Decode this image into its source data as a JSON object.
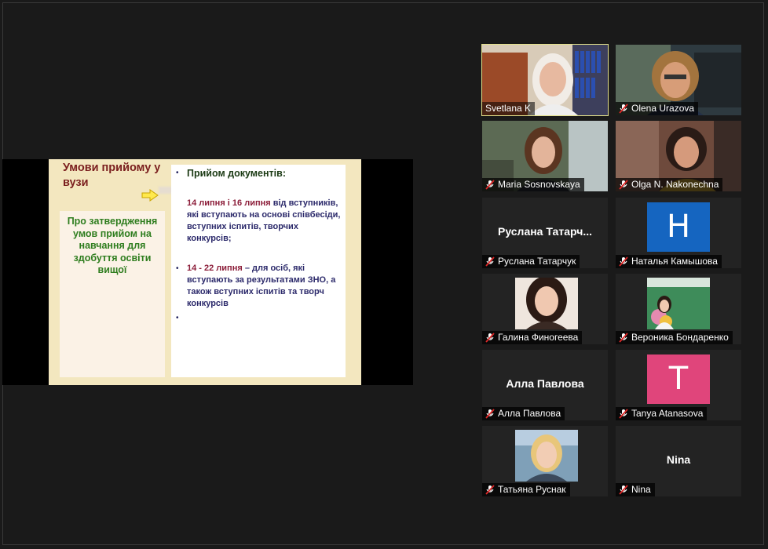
{
  "slide": {
    "title": "Умови прийому у вузи",
    "left_text": "Про затвердження умов прийом на навчання для здобуття освіти вищої",
    "heading": "Прийом документів:",
    "item1_dates": "14 липня і 16 липня",
    "item1_text": " від вступників, які вступають на основі співбесіди, вступних іспитів, творчих конкурсів;",
    "item2_dates": "14 - 22 липня",
    "item2_text": " – для осіб, які вступають за результатами ЗНО, а також вступних іспитів та творч конкурсів",
    "bullet": "•"
  },
  "participants": [
    {
      "name": "Svetlana K",
      "muted": false,
      "active": true
    },
    {
      "name": "Olena Urazova",
      "muted": true
    },
    {
      "name": "Maria Sosnovskaya",
      "muted": true
    },
    {
      "name": "Olga N. Nakonechna",
      "muted": true
    },
    {
      "name": "Руслана Татарчук",
      "display": "Руслана  Татарч...",
      "muted": true
    },
    {
      "name": "Наталья Камышова",
      "avatar": "H",
      "avatar_color": "#1565c0",
      "muted": true
    },
    {
      "name": "Галина Финогеева",
      "muted": true
    },
    {
      "name": "Вероника Бондаренко",
      "muted": true
    },
    {
      "name": "Алла Павлова",
      "display": "Алла Павлова",
      "muted": true
    },
    {
      "name": "Tanya Atanasova",
      "avatar": "T",
      "avatar_color": "#e0457b",
      "muted": true
    },
    {
      "name": "Татьяна Руснак",
      "muted": true
    },
    {
      "name": "Nina",
      "display": "Nina",
      "muted": true
    }
  ]
}
